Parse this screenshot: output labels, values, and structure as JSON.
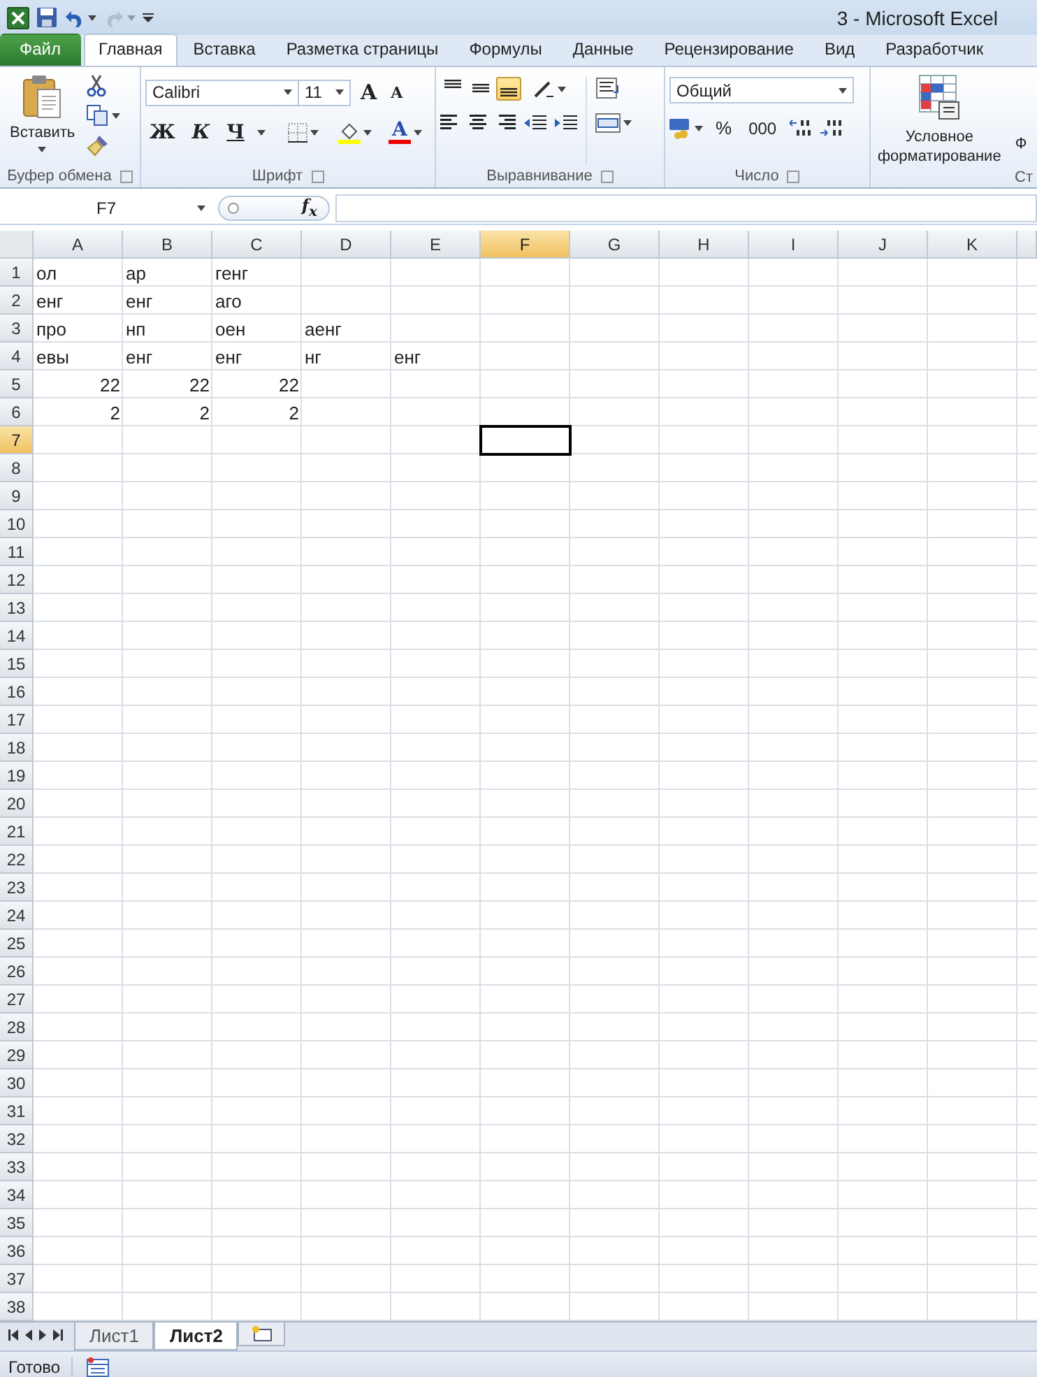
{
  "quick_access": [
    {
      "kind": "excel",
      "disabled": false
    },
    {
      "kind": "save",
      "disabled": false
    },
    {
      "kind": "undo",
      "disabled": false
    },
    {
      "kind": "redo",
      "disabled": true
    },
    {
      "kind": "customize",
      "disabled": false
    }
  ],
  "window": {
    "title": "3  -  Microsoft Excel"
  },
  "ribbon_tabs": [
    {
      "label": "Файл",
      "kind": "file",
      "selected": false
    },
    {
      "label": "Главная",
      "kind": "tab",
      "selected": true
    },
    {
      "label": "Вставка",
      "kind": "tab",
      "selected": false
    },
    {
      "label": "Разметка страницы",
      "kind": "tab",
      "selected": false
    },
    {
      "label": "Формулы",
      "kind": "tab",
      "selected": false
    },
    {
      "label": "Данные",
      "kind": "tab",
      "selected": false
    },
    {
      "label": "Рецензирование",
      "kind": "tab",
      "selected": false
    },
    {
      "label": "Вид",
      "kind": "tab",
      "selected": false
    },
    {
      "label": "Разработчик",
      "kind": "tab",
      "selected": false
    }
  ],
  "ribbon": {
    "clipboard": {
      "paste_label": "Вставить",
      "group_label": "Буфер обмена"
    },
    "font": {
      "font_name": "Calibri",
      "font_size": "11",
      "grow": "A",
      "shrink": "A",
      "bold": "Ж",
      "italic": "К",
      "underline": "Ч",
      "font_color": "A",
      "group_label": "Шрифт"
    },
    "alignment": {
      "vertical": [
        {
          "kind": "top",
          "selected": false
        },
        {
          "kind": "middle",
          "selected": false
        },
        {
          "kind": "bottom",
          "selected": true
        }
      ],
      "group_label": "Выравнивание"
    },
    "number": {
      "format": "Общий",
      "percent": "%",
      "thousands": "000",
      "group_label": "Число"
    },
    "styles": {
      "conditional_lines": [
        "Условное",
        "форматирование"
      ],
      "next_fragment": "Ф",
      "group_label": "Ст"
    }
  },
  "formula_bar": {
    "name_box": "F7",
    "function_label": "f$_{x}$"
  },
  "sheet": {
    "columns": [
      {
        "label": "A",
        "selected": false
      },
      {
        "label": "B",
        "selected": false
      },
      {
        "label": "C",
        "selected": false
      },
      {
        "label": "D",
        "selected": false
      },
      {
        "label": "E",
        "selected": false
      },
      {
        "label": "F",
        "selected": true
      },
      {
        "label": "G",
        "selected": false
      },
      {
        "label": "H",
        "selected": false
      },
      {
        "label": "I",
        "selected": false
      },
      {
        "label": "J",
        "selected": false
      },
      {
        "label": "K",
        "selected": false
      }
    ],
    "rows": [
      {
        "label": "1",
        "selected": false,
        "kind": "text",
        "cells": [
          "ол",
          "ар",
          "генг"
        ]
      },
      {
        "label": "2",
        "selected": false,
        "kind": "text",
        "cells": [
          "енг",
          "енг",
          "аго"
        ]
      },
      {
        "label": "3",
        "selected": false,
        "kind": "text",
        "cells": [
          "про",
          "нп",
          "оен",
          "аенг"
        ]
      },
      {
        "label": "4",
        "selected": false,
        "kind": "text",
        "cells": [
          "евы",
          "енг",
          "енг",
          "нг",
          "енг"
        ]
      },
      {
        "label": "5",
        "selected": false,
        "kind": "number",
        "cells": [
          "22",
          "22",
          "22"
        ]
      },
      {
        "label": "6",
        "selected": false,
        "kind": "number",
        "cells": [
          "2",
          "2",
          "2"
        ]
      },
      {
        "label": "7",
        "selected": true,
        "kind": "text",
        "cells": []
      },
      {
        "label": "8",
        "selected": false,
        "kind": "text",
        "cells": []
      },
      {
        "label": "9",
        "selected": false,
        "kind": "text",
        "cells": []
      },
      {
        "label": "10",
        "selected": false,
        "kind": "text",
        "cells": []
      },
      {
        "label": "11",
        "selected": false,
        "kind": "text",
        "cells": []
      },
      {
        "label": "12",
        "selected": false,
        "kind": "text",
        "cells": []
      },
      {
        "label": "13",
        "selected": false,
        "kind": "text",
        "cells": []
      },
      {
        "label": "14",
        "selected": false,
        "kind": "text",
        "cells": []
      },
      {
        "label": "15",
        "selected": false,
        "kind": "text",
        "cells": []
      },
      {
        "label": "16",
        "selected": false,
        "kind": "text",
        "cells": []
      },
      {
        "label": "17",
        "selected": false,
        "kind": "text",
        "cells": []
      },
      {
        "label": "18",
        "selected": false,
        "kind": "text",
        "cells": []
      },
      {
        "label": "19",
        "selected": false,
        "kind": "text",
        "cells": []
      },
      {
        "label": "20",
        "selected": false,
        "kind": "text",
        "cells": []
      },
      {
        "label": "21",
        "selected": false,
        "kind": "text",
        "cells": []
      },
      {
        "label": "22",
        "selected": false,
        "kind": "text",
        "cells": []
      },
      {
        "label": "23",
        "selected": false,
        "kind": "text",
        "cells": []
      },
      {
        "label": "24",
        "selected": false,
        "kind": "text",
        "cells": []
      },
      {
        "label": "25",
        "selected": false,
        "kind": "text",
        "cells": []
      },
      {
        "label": "26",
        "selected": false,
        "kind": "text",
        "cells": []
      },
      {
        "label": "27",
        "selected": false,
        "kind": "text",
        "cells": []
      },
      {
        "label": "28",
        "selected": false,
        "kind": "text",
        "cells": []
      },
      {
        "label": "29",
        "selected": false,
        "kind": "text",
        "cells": []
      },
      {
        "label": "30",
        "selected": false,
        "kind": "text",
        "cells": []
      },
      {
        "label": "31",
        "selected": false,
        "kind": "text",
        "cells": []
      },
      {
        "label": "32",
        "selected": false,
        "kind": "text",
        "cells": []
      },
      {
        "label": "33",
        "selected": false,
        "kind": "text",
        "cells": []
      },
      {
        "label": "34",
        "selected": false,
        "kind": "text",
        "cells": []
      },
      {
        "label": "35",
        "selected": false,
        "kind": "text",
        "cells": []
      },
      {
        "label": "36",
        "selected": false,
        "kind": "text",
        "cells": []
      },
      {
        "label": "37",
        "selected": false,
        "kind": "text",
        "cells": []
      },
      {
        "label": "38",
        "selected": false,
        "kind": "text",
        "cells": []
      }
    ]
  },
  "sheet_tabs": [
    {
      "label": "Лист1",
      "selected": false
    },
    {
      "label": "Лист2",
      "selected": true
    }
  ],
  "status_bar": {
    "text": "Готово"
  }
}
